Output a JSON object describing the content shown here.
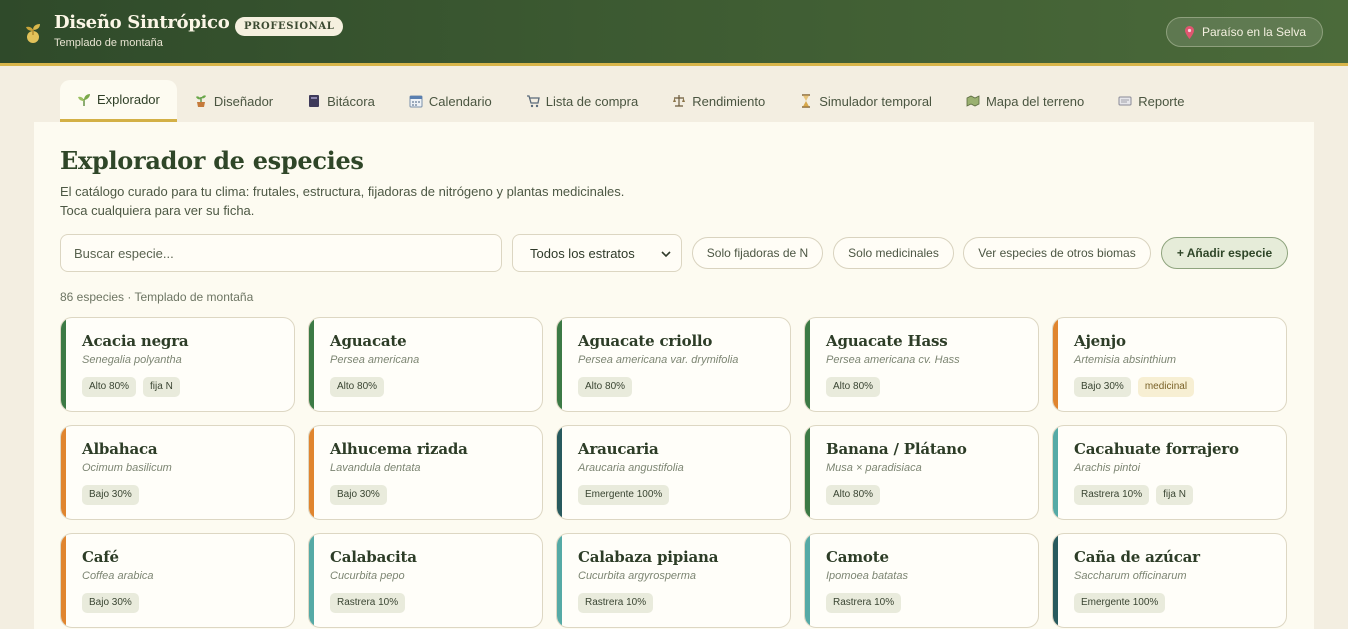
{
  "header": {
    "title": "Diseño Sintrópico",
    "subtitle": "Templado de montaña",
    "plan_badge": "PROFESIONAL",
    "location_label": "Paraíso en la Selva"
  },
  "tabs": [
    {
      "label": "Explorador",
      "icon": "seedling-icon",
      "active": true
    },
    {
      "label": "Diseñador",
      "icon": "potted-plant-icon",
      "active": false
    },
    {
      "label": "Bitácora",
      "icon": "notebook-icon",
      "active": false
    },
    {
      "label": "Calendario",
      "icon": "calendar-icon",
      "active": false
    },
    {
      "label": "Lista de compra",
      "icon": "cart-icon",
      "active": false
    },
    {
      "label": "Rendimiento",
      "icon": "scale-icon",
      "active": false
    },
    {
      "label": "Simulador temporal",
      "icon": "hourglass-icon",
      "active": false
    },
    {
      "label": "Mapa del terreno",
      "icon": "map-icon",
      "active": false
    },
    {
      "label": "Reporte",
      "icon": "report-icon",
      "active": false
    }
  ],
  "main": {
    "title": "Explorador de especies",
    "description_line1": "El catálogo curado para tu clima: frutales, estructura, fijadoras de nitrógeno y plantas medicinales.",
    "description_line2": "Toca cualquiera para ver su ficha.",
    "search_placeholder": "Buscar especie...",
    "strata_filter": "Todos los estratos",
    "chips": [
      "Solo fijadoras de N",
      "Solo medicinales",
      "Ver especies de otros biomas"
    ],
    "add_button": "+ Añadir especie",
    "count_text": "86 especies · Templado de montaña"
  },
  "colors": {
    "alto": "#3c7a45",
    "bajo": "#e0852f",
    "emergente": "#285a5e",
    "rastrera": "#55aaa6"
  },
  "species": [
    {
      "name": "Acacia negra",
      "scientific": "Senegalia polyantha",
      "stratum": "alto",
      "tags": [
        "Alto 80%",
        "fija N"
      ]
    },
    {
      "name": "Aguacate",
      "scientific": "Persea americana",
      "stratum": "alto",
      "tags": [
        "Alto 80%"
      ]
    },
    {
      "name": "Aguacate criollo",
      "scientific": "Persea americana var. drymifolia",
      "stratum": "alto",
      "tags": [
        "Alto 80%"
      ]
    },
    {
      "name": "Aguacate Hass",
      "scientific": "Persea americana cv. Hass",
      "stratum": "alto",
      "tags": [
        "Alto 80%"
      ]
    },
    {
      "name": "Ajenjo",
      "scientific": "Artemisia absinthium",
      "stratum": "bajo",
      "tags": [
        "Bajo 30%",
        "medicinal"
      ]
    },
    {
      "name": "Albahaca",
      "scientific": "Ocimum basilicum",
      "stratum": "bajo",
      "tags": [
        "Bajo 30%"
      ]
    },
    {
      "name": "Alhucema rizada",
      "scientific": "Lavandula dentata",
      "stratum": "bajo",
      "tags": [
        "Bajo 30%"
      ]
    },
    {
      "name": "Araucaria",
      "scientific": "Araucaria angustifolia",
      "stratum": "emergente",
      "tags": [
        "Emergente 100%"
      ]
    },
    {
      "name": "Banana / Plátano",
      "scientific": "Musa × paradisiaca",
      "stratum": "alto",
      "tags": [
        "Alto 80%"
      ]
    },
    {
      "name": "Cacahuate forrajero",
      "scientific": "Arachis pintoi",
      "stratum": "rastrera",
      "tags": [
        "Rastrera 10%",
        "fija N"
      ]
    },
    {
      "name": "Café",
      "scientific": "Coffea arabica",
      "stratum": "bajo",
      "tags": [
        "Bajo 30%"
      ]
    },
    {
      "name": "Calabacita",
      "scientific": "Cucurbita pepo",
      "stratum": "rastrera",
      "tags": [
        "Rastrera 10%"
      ]
    },
    {
      "name": "Calabaza pipiana",
      "scientific": "Cucurbita argyrosperma",
      "stratum": "rastrera",
      "tags": [
        "Rastrera 10%"
      ]
    },
    {
      "name": "Camote",
      "scientific": "Ipomoea batatas",
      "stratum": "rastrera",
      "tags": [
        "Rastrera 10%"
      ]
    },
    {
      "name": "Caña de azúcar",
      "scientific": "Saccharum officinarum",
      "stratum": "emergente",
      "tags": [
        "Emergente 100%"
      ]
    }
  ]
}
